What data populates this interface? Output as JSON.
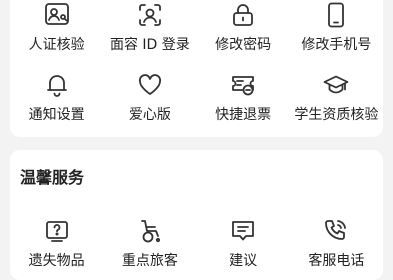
{
  "account_section": {
    "row1": [
      {
        "label": "人证核验",
        "icon": "id-card-icon"
      },
      {
        "label": "面容 ID 登录",
        "icon": "face-scan-icon"
      },
      {
        "label": "修改密码",
        "icon": "lock-icon"
      },
      {
        "label": "修改手机号",
        "icon": "phone-icon"
      }
    ],
    "row2": [
      {
        "label": "通知设置",
        "icon": "bell-icon"
      },
      {
        "label": "爱心版",
        "icon": "heart-icon"
      },
      {
        "label": "快捷退票",
        "icon": "ticket-refund-icon"
      },
      {
        "label": "学生资质核验",
        "icon": "graduation-cap-icon"
      }
    ]
  },
  "service_section": {
    "title": "温馨服务",
    "items": [
      {
        "label": "遗失物品",
        "icon": "question-box-icon"
      },
      {
        "label": "重点旅客",
        "icon": "wheelchair-icon"
      },
      {
        "label": "建议",
        "icon": "message-icon"
      },
      {
        "label": "客服电话",
        "icon": "phone-call-icon"
      }
    ]
  },
  "colors": {
    "background": "#f3f3f3",
    "card": "#ffffff",
    "text": "#222222",
    "icon_stroke": "#333333"
  }
}
